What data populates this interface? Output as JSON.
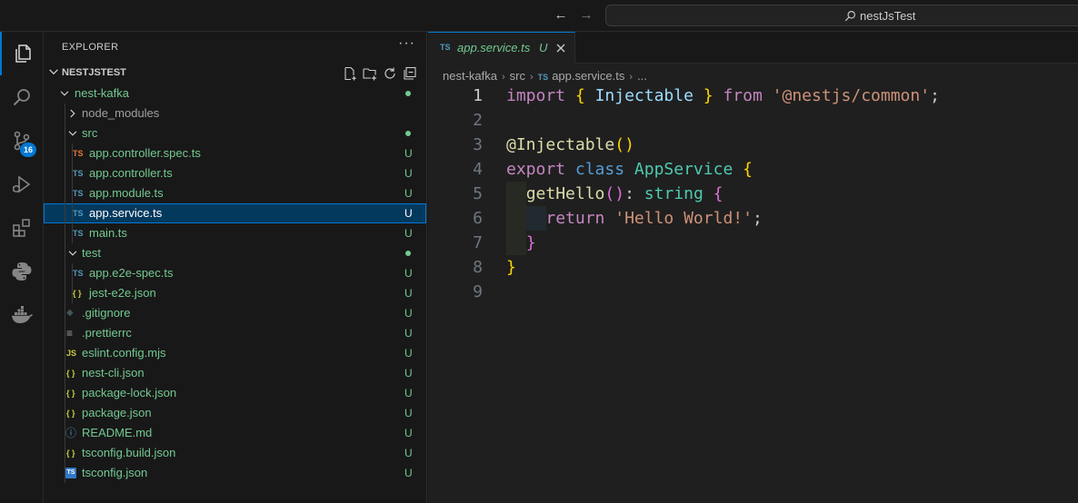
{
  "titlebar": {
    "back_icon": "arrow-left-icon",
    "forward_icon": "arrow-right-icon",
    "search_text": "nestJsTest"
  },
  "activity_bar": {
    "items": [
      {
        "icon": "files-icon",
        "active": true
      },
      {
        "icon": "search-icon"
      },
      {
        "icon": "source-control-icon",
        "badge": "16"
      },
      {
        "icon": "run-debug-icon"
      },
      {
        "icon": "extensions-icon"
      },
      {
        "icon": "python-icon"
      },
      {
        "icon": "docker-icon"
      }
    ]
  },
  "sidebar": {
    "title": "EXPLORER",
    "more": "···",
    "section_title": "NESTJSTEST",
    "tree": [
      {
        "name": "nest-kafka",
        "type": "folder",
        "expanded": true,
        "depth": 1,
        "status": "dot"
      },
      {
        "name": "node_modules",
        "type": "folder",
        "expanded": false,
        "depth": 2,
        "status": ""
      },
      {
        "name": "src",
        "type": "folder",
        "expanded": true,
        "depth": 2,
        "status": "dot"
      },
      {
        "name": "app.controller.spec.ts",
        "type": "ts-red",
        "icon_text": "TS",
        "depth": 3,
        "status": "U"
      },
      {
        "name": "app.controller.ts",
        "type": "ts",
        "icon_text": "TS",
        "depth": 3,
        "status": "U"
      },
      {
        "name": "app.module.ts",
        "type": "ts",
        "icon_text": "TS",
        "depth": 3,
        "status": "U"
      },
      {
        "name": "app.service.ts",
        "type": "ts",
        "icon_text": "TS",
        "depth": 3,
        "status": "U",
        "selected": true
      },
      {
        "name": "main.ts",
        "type": "ts",
        "icon_text": "TS",
        "depth": 3,
        "status": "U"
      },
      {
        "name": "test",
        "type": "folder",
        "expanded": true,
        "depth": 2,
        "status": "dot"
      },
      {
        "name": "app.e2e-spec.ts",
        "type": "ts",
        "icon_text": "TS",
        "depth": 3,
        "status": "U"
      },
      {
        "name": "jest-e2e.json",
        "type": "json",
        "icon_text": "{ }",
        "depth": 3,
        "status": "U"
      },
      {
        "name": ".gitignore",
        "type": "git",
        "icon_text": "◆",
        "depth": 2,
        "status": "U"
      },
      {
        "name": ".prettierrc",
        "type": "config",
        "icon_text": "≡",
        "depth": 2,
        "status": "U"
      },
      {
        "name": "eslint.config.mjs",
        "type": "js",
        "icon_text": "JS",
        "depth": 2,
        "status": "U"
      },
      {
        "name": "nest-cli.json",
        "type": "json",
        "icon_text": "{ }",
        "depth": 2,
        "status": "U"
      },
      {
        "name": "package-lock.json",
        "type": "json",
        "icon_text": "{ }",
        "depth": 2,
        "status": "U"
      },
      {
        "name": "package.json",
        "type": "json",
        "icon_text": "{ }",
        "depth": 2,
        "status": "U"
      },
      {
        "name": "README.md",
        "type": "info",
        "icon_text": "ⓘ",
        "depth": 2,
        "status": "U"
      },
      {
        "name": "tsconfig.build.json",
        "type": "json",
        "icon_text": "{ }",
        "depth": 2,
        "status": "U"
      },
      {
        "name": "tsconfig.json",
        "type": "tsconfig",
        "icon_text": "TS",
        "depth": 2,
        "status": "U"
      }
    ]
  },
  "editor": {
    "tab": {
      "icon_text": "TS",
      "name": "app.service.ts",
      "status": "U"
    },
    "breadcrumb": {
      "root": "nest-kafka",
      "folder": "src",
      "icon_text": "TS",
      "file": "app.service.ts",
      "more": "..."
    },
    "code_lines": [
      {
        "n": "1",
        "tokens": [
          [
            "import",
            "k-imp"
          ],
          [
            " ",
            ""
          ],
          [
            "{",
            "b-gold"
          ],
          [
            " ",
            ""
          ],
          [
            "Injectable",
            "var"
          ],
          [
            " ",
            ""
          ],
          [
            "}",
            "b-gold"
          ],
          [
            " ",
            ""
          ],
          [
            "from",
            "k-imp"
          ],
          [
            " ",
            ""
          ],
          [
            "'@nestjs/common'",
            "str"
          ],
          [
            ";",
            ""
          ]
        ]
      },
      {
        "n": "2",
        "tokens": []
      },
      {
        "n": "3",
        "tokens": [
          [
            "@",
            "fn"
          ],
          [
            "Injectable",
            "fn"
          ],
          [
            "(",
            "b-gold"
          ],
          [
            ")",
            "b-gold"
          ]
        ]
      },
      {
        "n": "4",
        "tokens": [
          [
            "export",
            "k-imp"
          ],
          [
            " ",
            ""
          ],
          [
            "class",
            "k-blue"
          ],
          [
            " ",
            ""
          ],
          [
            "AppService",
            "cls"
          ],
          [
            " ",
            ""
          ],
          [
            "{",
            "b-gold"
          ]
        ]
      },
      {
        "n": "5",
        "tokens": [
          [
            "  ",
            ""
          ],
          [
            "getHello",
            "fn"
          ],
          [
            "(",
            "b-pink"
          ],
          [
            ")",
            "b-pink"
          ],
          [
            ": ",
            ""
          ],
          [
            "string",
            "typ"
          ],
          [
            " ",
            ""
          ],
          [
            "{",
            "b-pink"
          ]
        ]
      },
      {
        "n": "6",
        "tokens": [
          [
            "    ",
            ""
          ],
          [
            "return",
            "k-imp"
          ],
          [
            " ",
            ""
          ],
          [
            "'Hello World!'",
            "str"
          ],
          [
            ";",
            ""
          ]
        ]
      },
      {
        "n": "7",
        "tokens": [
          [
            "  ",
            ""
          ],
          [
            "}",
            "b-pink"
          ]
        ]
      },
      {
        "n": "8",
        "tokens": [
          [
            "}",
            "b-gold"
          ]
        ]
      },
      {
        "n": "9",
        "tokens": []
      }
    ],
    "current_line": "1"
  }
}
